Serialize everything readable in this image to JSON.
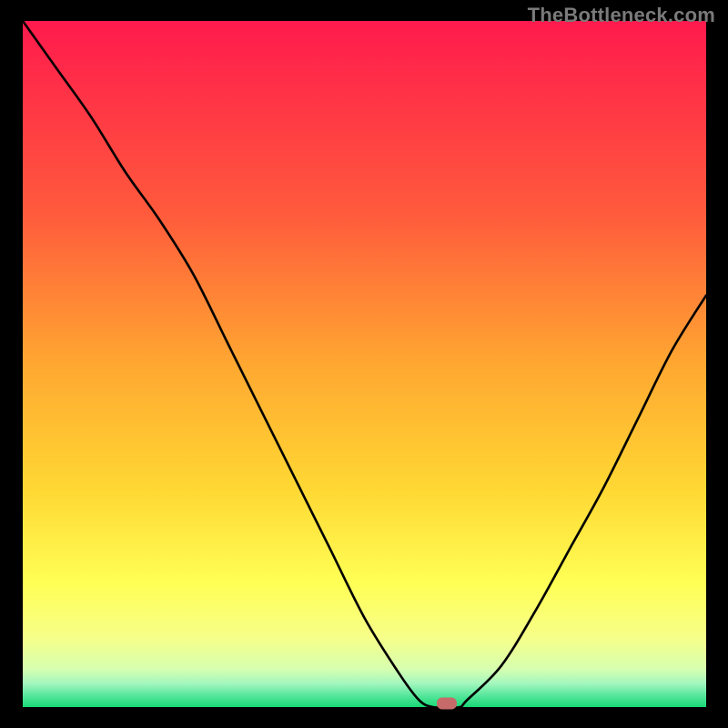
{
  "watermark": "TheBottleneck.com",
  "chart_data": {
    "type": "line",
    "title": "",
    "xlabel": "",
    "ylabel": "",
    "xlim": [
      0,
      100
    ],
    "ylim": [
      0,
      100
    ],
    "x": [
      0,
      5,
      10,
      15,
      20,
      25,
      30,
      35,
      40,
      45,
      50,
      55,
      58,
      60,
      62,
      64,
      65,
      70,
      75,
      80,
      85,
      90,
      95,
      100
    ],
    "values": [
      100,
      93,
      86,
      78,
      71,
      63,
      53,
      43,
      33,
      23,
      13,
      5,
      1,
      0,
      0,
      0,
      1,
      6,
      14,
      23,
      32,
      42,
      52,
      60
    ],
    "marker": {
      "x": 62,
      "y": 0
    },
    "gradient_stops": [
      {
        "pos": 0.0,
        "color": "#ff1a4d"
      },
      {
        "pos": 0.28,
        "color": "#ff5a3c"
      },
      {
        "pos": 0.5,
        "color": "#ffa731"
      },
      {
        "pos": 0.68,
        "color": "#ffd733"
      },
      {
        "pos": 0.82,
        "color": "#ffff55"
      },
      {
        "pos": 0.9,
        "color": "#f6ff8a"
      },
      {
        "pos": 0.945,
        "color": "#d6ffb0"
      },
      {
        "pos": 0.965,
        "color": "#a5f7bf"
      },
      {
        "pos": 0.985,
        "color": "#4fe598"
      },
      {
        "pos": 1.0,
        "color": "#18d874"
      }
    ]
  }
}
